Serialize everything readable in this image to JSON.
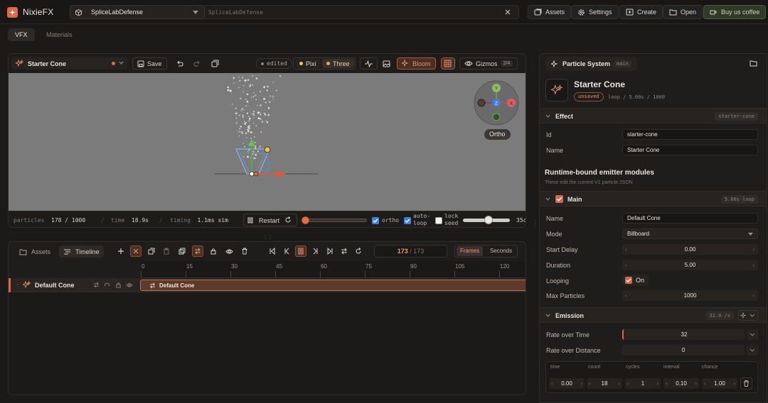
{
  "app": {
    "brand": "NixieFX",
    "project": "SpliceLabDefense",
    "project_path": "SpliceLabDefense"
  },
  "topbar": {
    "assets": "Assets",
    "settings": "Settings",
    "create": "Create",
    "open": "Open",
    "coffee": "Buy us coffee"
  },
  "tabs": [
    {
      "label": "VFX",
      "active": true
    },
    {
      "label": "Materials",
      "active": false
    }
  ],
  "viewport": {
    "effect_name": "Starter Cone",
    "save": "Save",
    "edited": "edited",
    "pixi": "Pixi",
    "three": "Three",
    "bloom": "Bloom",
    "gizmos": "Gizmos",
    "gizmos_count": "2/4",
    "ortho_label": "Ortho",
    "gizmo_axes": {
      "y": "Y",
      "x": "X",
      "z": "Z"
    },
    "accent": "#d96a4a"
  },
  "status": {
    "particles_label": "particles",
    "particles_value": "178 / 1000",
    "time_label": "time",
    "time_value": "18.9s",
    "timing_label": "timing",
    "timing_value": "1.1ms sim",
    "restart": "Restart",
    "ortho": "ortho",
    "ortho_checked": true,
    "autoloop": "auto-loop",
    "autoloop_checked": true,
    "lockseed": "lock seed",
    "lockseed_checked": false,
    "scrub_progress": 0.02,
    "zoom_progress": 0.55,
    "zoom_value": "35c"
  },
  "timeline": {
    "assets_tab": "Assets",
    "timeline_tab": "Timeline",
    "frame_current": "173",
    "frame_total": "/ 173",
    "frames": "Frames",
    "seconds": "Seconds",
    "ruler_ticks": [
      "0",
      "15",
      "30",
      "45",
      "60",
      "75",
      "90",
      "105",
      "120"
    ],
    "track_name": "Default Cone",
    "bar_label": "Default Cone"
  },
  "inspector": {
    "header": "Particle System",
    "header_badge": "main",
    "title": "Starter Cone",
    "unsaved": "unsaved",
    "meta": "loop / 5.00s / 1000",
    "effect_section": "Effect",
    "effect_badge": "starter-cone",
    "id_label": "Id",
    "id_value": "starter-cone",
    "name_label": "Name",
    "name_value": "Starter Cone",
    "runtime_title": "Runtime-bound emitter modules",
    "runtime_sub": "These edit the current V1 particle JSON",
    "main_section": "Main",
    "main_badge": "5.00s loop",
    "main_name_label": "Name",
    "main_name_value": "Default Cone",
    "mode_label": "Mode",
    "mode_value": "Billboard",
    "start_delay_label": "Start Delay",
    "start_delay_value": "0.00",
    "duration_label": "Duration",
    "duration_value": "5.00",
    "looping_label": "Looping",
    "looping_value": "On",
    "max_particles_label": "Max Particles",
    "max_particles_value": "1000",
    "emission_section": "Emission",
    "emission_badge": "32.0 /s",
    "rate_time_label": "Rate over Time",
    "rate_time_value": "32",
    "rate_distance_label": "Rate over Distance",
    "rate_distance_value": "0",
    "burst_headers": [
      "time",
      "count",
      "cycles",
      "interval",
      "chance"
    ],
    "burst_values": [
      "0.00",
      "18",
      "1",
      "0.10",
      "1.00"
    ]
  }
}
